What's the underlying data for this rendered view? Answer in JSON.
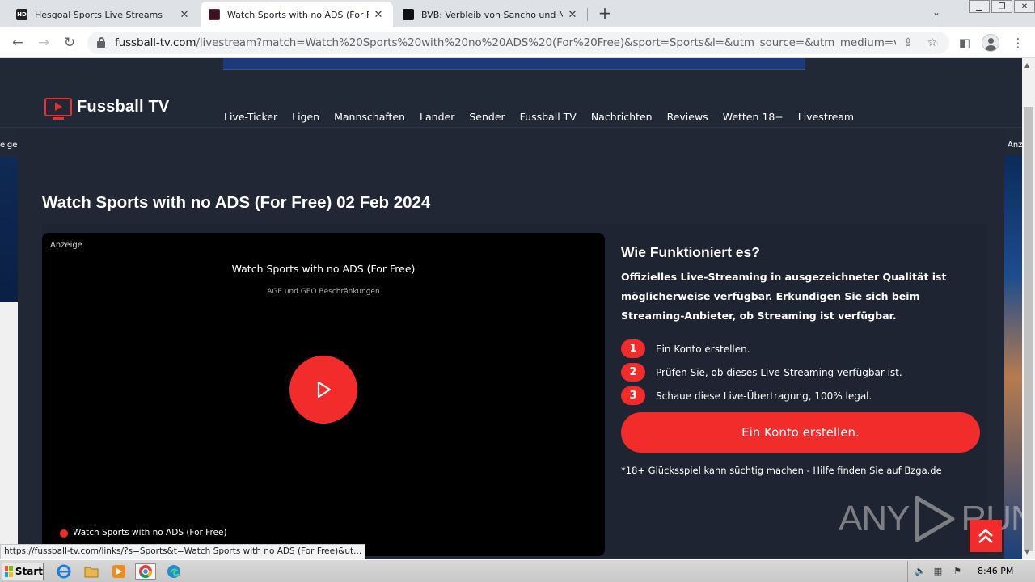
{
  "browser": {
    "tabs": [
      {
        "title": "Hesgoal Sports Live Streams",
        "favicon": "HD"
      },
      {
        "title": "Watch Sports with no ADS (For Free",
        "favicon": ""
      },
      {
        "title": "BVB: Verbleib von Sancho und Maats",
        "favicon": ""
      }
    ],
    "url_host": "fussball-tv.com",
    "url_path": "/livestream?match=Watch%20Sports%20with%20no%20ADS%20(For%20Free)&sport=Sports&l=&utm_source=&utm_medium=vplayer...",
    "status_url": "https://fussball-tv.com/links/?s=Sports&t=Watch Sports with no ADS (For Free)&ut..."
  },
  "site": {
    "logo_text": "Fussball TV",
    "nav": [
      "Live-Ticker",
      "Ligen",
      "Mannschaften",
      "Lander",
      "Sender",
      "Fussball TV",
      "Nachrichten",
      "Reviews",
      "Wetten 18+",
      "Livestream"
    ],
    "side_ad_left_label": "eige",
    "side_ad_right_label": "Anz",
    "page_title": "Watch Sports with no ADS (For Free) 02 Feb 2024"
  },
  "player": {
    "ad_label": "Anzeige",
    "title": "Watch Sports with no ADS (For Free)",
    "subtitle": "AGE und GEO Beschränkungen",
    "footer": "Watch Sports with no ADS (For Free)"
  },
  "info": {
    "heading": "Wie Funktioniert es?",
    "description": "Offizielles Live-Streaming in ausgezeichneter Qualität ist möglicherweise verfügbar. Erkundigen Sie sich beim Streaming-Anbieter, ob Streaming ist verfügbar.",
    "steps": [
      {
        "num": "1",
        "text": "Ein Konto erstellen."
      },
      {
        "num": "2",
        "text": "Prüfen Sie, ob dieses Live-Streaming verfügbar ist."
      },
      {
        "num": "3",
        "text": "Schaue diese Live-Übertragung, 100% legal."
      }
    ],
    "cta": "Ein Konto erstellen.",
    "disclaimer": "*18+ Glücksspiel kann süchtig machen - Hilfe finden Sie auf Bzga.de"
  },
  "watermark": {
    "left": "ANY",
    "right": "RUN"
  },
  "taskbar": {
    "start": "Start",
    "clock": "8:46 PM"
  },
  "colors": {
    "accent": "#f22b2b",
    "page_bg": "#222936",
    "brand_blue": "#1d3a78"
  }
}
